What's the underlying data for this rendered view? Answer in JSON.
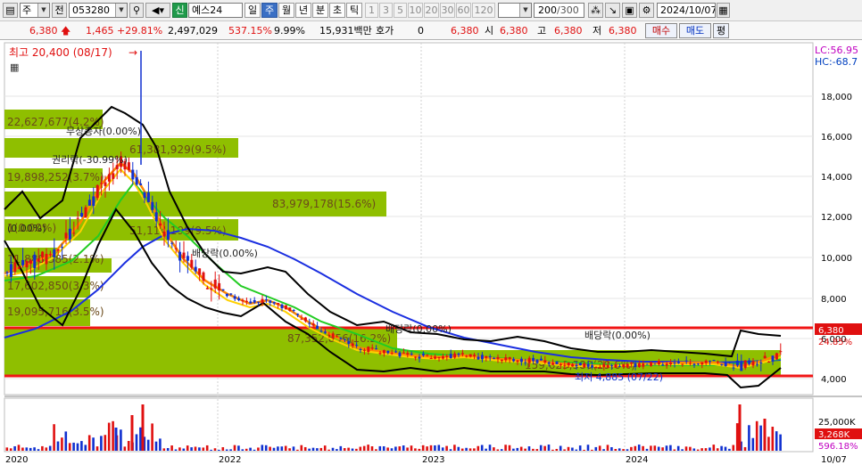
{
  "toolbar": {
    "window_icon": "window-icon",
    "market_combo": "주",
    "search_label": "전",
    "code_value": "053280",
    "name_prefix": "신",
    "name_value": "예스24",
    "periods": [
      "일",
      "주",
      "월",
      "년",
      "분",
      "초",
      "틱"
    ],
    "active_period": "주",
    "intervals": [
      "1",
      "3",
      "5",
      "10",
      "20",
      "30",
      "60",
      "120"
    ],
    "count_value": "200",
    "count_total": "/300",
    "date_value": "2024/10/07"
  },
  "quote": {
    "price": "6,380",
    "change": "1,465",
    "change_pct": "+29.81%",
    "volume": "2,497,029",
    "volume_pct": "537.15%",
    "turnover_pct": "9.99%",
    "amount": "15,931백만",
    "hoga_label": "호가",
    "hoga_value": "0",
    "ask_price": "6,380",
    "open_label": "시",
    "open_value": "6,380",
    "high_label": "고",
    "high_value": "6,380",
    "low_label": "저",
    "low_value": "6,380",
    "buy_label": "매수",
    "sell_label": "매도",
    "eval_label": "평"
  },
  "chart": {
    "price_axis": [
      "18,000",
      "16,000",
      "14,000",
      "12,000",
      "10,000",
      "8,000",
      "6,000",
      "4,000"
    ],
    "lc_label": "LC:56.95",
    "hc_label": "HC:-68.7",
    "current_price_tag": "6,380",
    "pct_tag": "24.85%",
    "volume_axis": "25,000K",
    "volume_tag": "3,268K",
    "volume_tag2": "596.18%",
    "date_labels": [
      "2020",
      "2022",
      "2023",
      "2024",
      "10/07"
    ],
    "high_annotation": "최고 20,400 (08/17)",
    "low_annotation": "최저 4,885 (07/22)",
    "events": [
      "무상증자(0.00%)",
      "권리락(-30.99%)",
      "배당락(0.00%)",
      "배당락(0.00%)",
      "배당락(0.00%)",
      "(0.00%)"
    ],
    "volume_profile": [
      "22,627,677(4.2%)",
      "61,381,929(9.5%)",
      "19,898,252(3.7%)",
      "83,979,178(15.6%)",
      "51,114,199(9.5%)",
      "1(0.00%)",
      "11,888,385(2.1%)",
      "17,602,850(3.3%)",
      "19,095,716(3.5%)",
      "87,352,856(16.2%)",
      "159,623,580(29.6%)"
    ]
  },
  "colors": {
    "up": "#e01010",
    "down": "#1030d0",
    "profile": "#8fbf00",
    "ma_blue": "#1a2ee0",
    "ma_green": "#22cc22",
    "ma_orange": "#ff8800",
    "ma_yellow": "#ffd000"
  }
}
